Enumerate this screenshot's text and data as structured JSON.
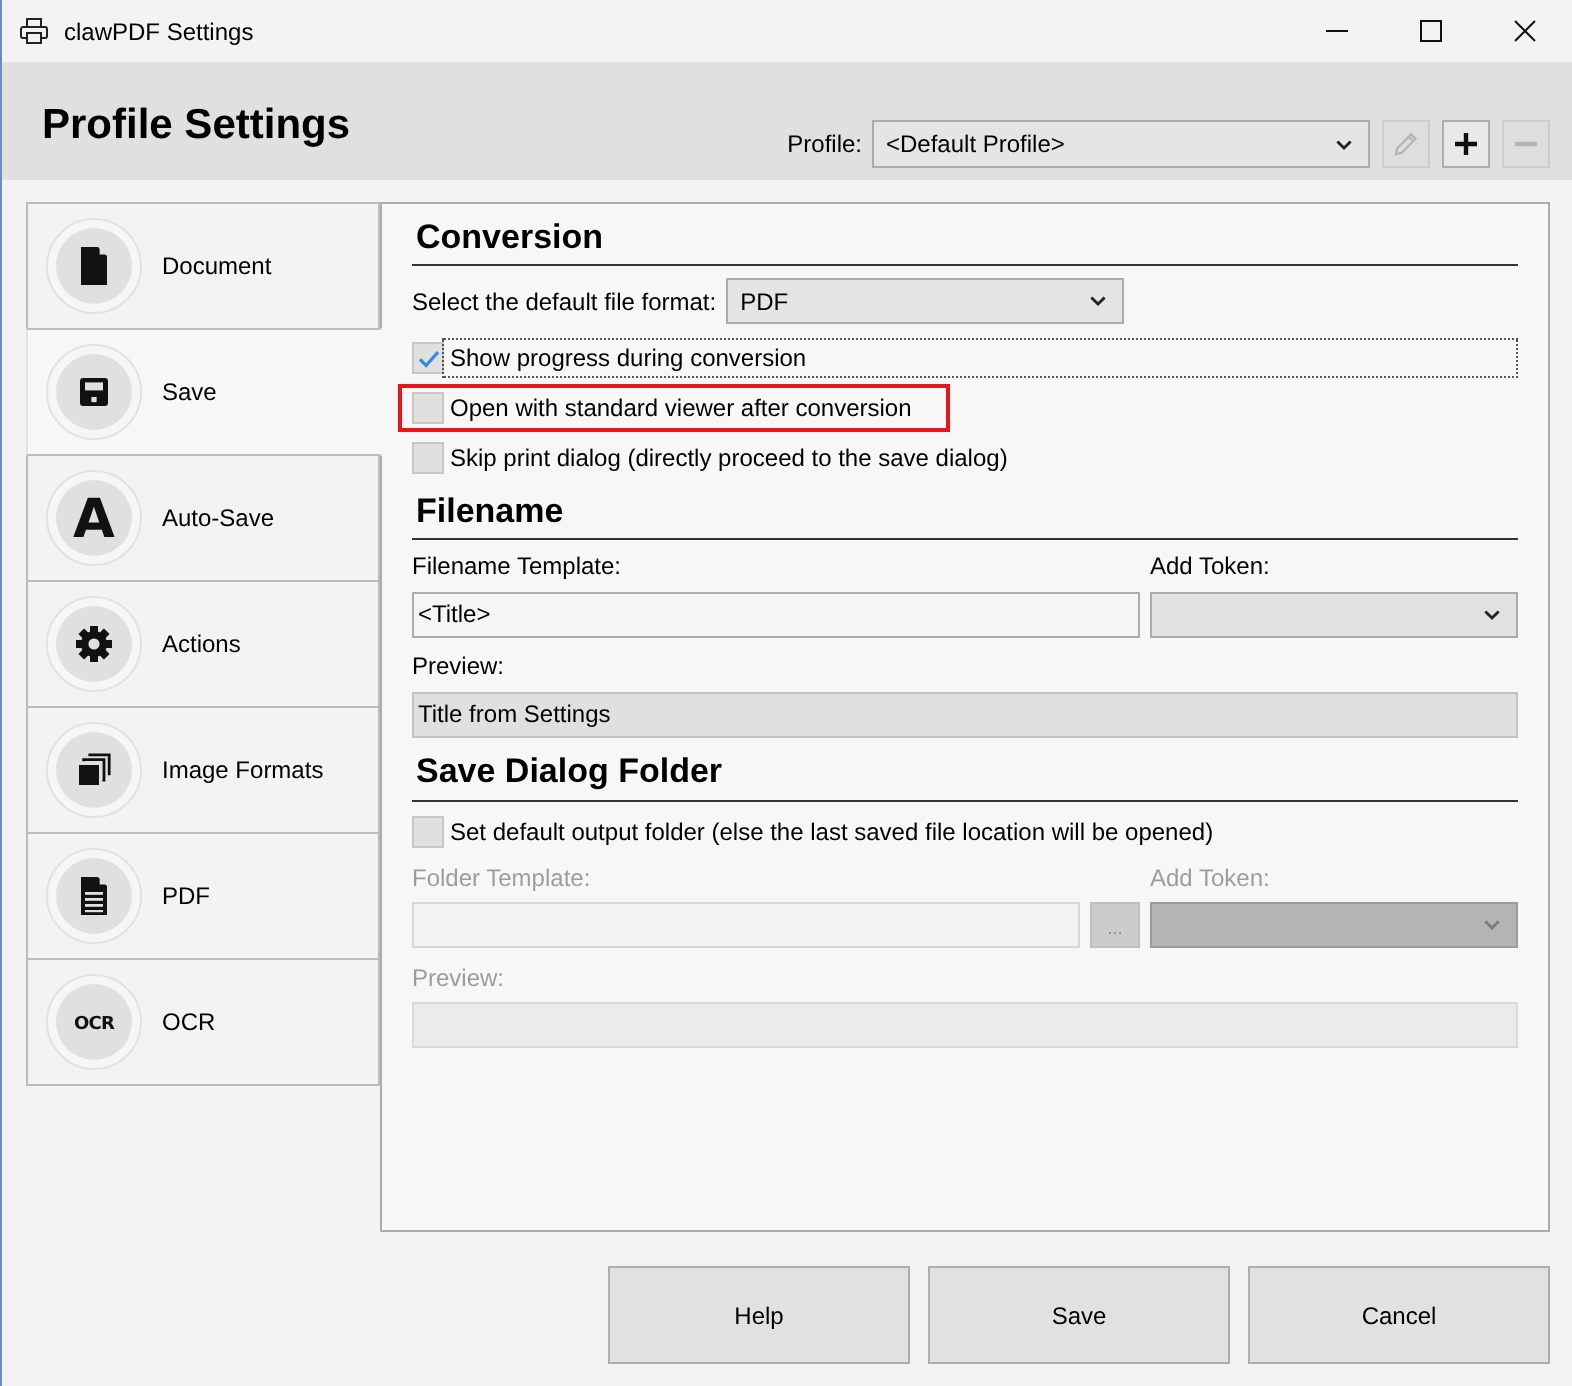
{
  "window": {
    "title": "clawPDF Settings"
  },
  "header": {
    "title": "Profile Settings",
    "profile_label": "Profile:",
    "profile_value": "<Default Profile>",
    "profile_buttons": [
      {
        "kind": "edit",
        "disabled": true
      },
      {
        "kind": "add",
        "disabled": false
      },
      {
        "kind": "remove",
        "disabled": true
      }
    ]
  },
  "sidebar": {
    "items": [
      {
        "kind": "document",
        "label": "Document",
        "selected": false
      },
      {
        "kind": "save",
        "label": "Save",
        "selected": true
      },
      {
        "kind": "letter",
        "glyph": "A",
        "label": "Auto-Save",
        "selected": false
      },
      {
        "kind": "gear",
        "label": "Actions",
        "selected": false
      },
      {
        "kind": "pages",
        "label": "Image Formats",
        "selected": false
      },
      {
        "kind": "pdf",
        "label": "PDF",
        "selected": false
      },
      {
        "kind": "ocr",
        "glyph": "OCR",
        "label": "OCR",
        "selected": false
      }
    ]
  },
  "conversion": {
    "title": "Conversion",
    "format_label": "Select the default file format:",
    "format_value": "PDF",
    "options": [
      {
        "label": "Show progress during conversion",
        "checked": true,
        "focused": true,
        "highlighted": false
      },
      {
        "label": "Open with standard viewer after conversion",
        "checked": false,
        "focused": false,
        "highlighted": true
      },
      {
        "label": "Skip print dialog (directly proceed to the save dialog)",
        "checked": false,
        "focused": false,
        "highlighted": false
      }
    ]
  },
  "filename": {
    "title": "Filename",
    "template_label": "Filename Template:",
    "template_value": "<Title>",
    "token_label": "Add Token:",
    "preview_label": "Preview:",
    "preview_value": "Title from Settings"
  },
  "save_dialog_folder": {
    "title": "Save Dialog Folder",
    "option": {
      "label": "Set default output folder (else the last saved file location will be opened)",
      "checked": false
    },
    "disabled": true,
    "template_label": "Folder Template:",
    "browse_button": "...",
    "token_label": "Add Token:",
    "preview_label": "Preview:"
  },
  "buttons": [
    "Help",
    "Save",
    "Cancel"
  ]
}
